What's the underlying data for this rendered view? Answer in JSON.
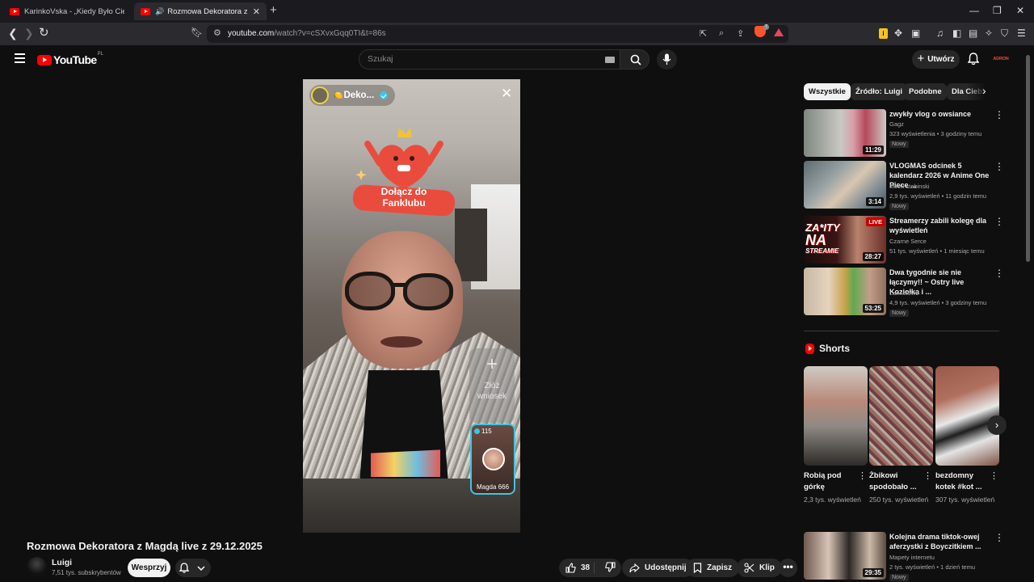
{
  "browser": {
    "tabs": [
      {
        "label": "KarinkoVska - „Kiedy Było Ciemno” (",
        "active": false
      },
      {
        "label": "Rozmowa Dekoratora z Magd",
        "active": true
      }
    ],
    "url_domain": "youtube.com",
    "url_path": "/watch?v=cSXvxGqq0TI&t=86s",
    "brave_badge": "7"
  },
  "masthead": {
    "logo_text": "YouTube",
    "country_code": "PL",
    "search_placeholder": "Szukaj",
    "create_label": "Utwórz",
    "avatar_text": "ADRON"
  },
  "player": {
    "channel_name": "Deko...",
    "channel_emoji": "🍋",
    "fan_club_line1": "Dołącz do",
    "fan_club_line2": "Fanklubu",
    "request_label_line1": "Złóż",
    "request_label_line2": "wniosek",
    "guest_count": "115",
    "guest_name": "Magda 666"
  },
  "video": {
    "title": "Rozmowa Dekoratora z Magdą live z 29.12.2025",
    "channel": "Luigi",
    "subscribers": "7,51 tys. subskrybentów",
    "support_label": "Wesprzyj",
    "likes": "38",
    "share_label": "Udostępnij",
    "save_label": "Zapisz",
    "clip_label": "Klip",
    "more_label": "•••"
  },
  "sidebar": {
    "chips": [
      "Wszystkie",
      "Źródło: Luigi",
      "Podobne",
      "Dla Ciebie"
    ],
    "recommendations": [
      {
        "title": "zwykły vlog o owsiance",
        "channel": "Gagz",
        "meta": "323 wyświetlenia • 3 godziny temu",
        "badge": "Nowy",
        "duration": "11:29"
      },
      {
        "title": "VLOGMAS odcinek 5 kalendarz 2026 w Anime One Piece ...",
        "channel": "Mirek stabinski",
        "meta": "2,9 tys. wyświetleń • 11 godzin temu",
        "badge": "Nowy",
        "duration": "3:14"
      },
      {
        "title": "Streamerzy zabili kolegę dla wyświetleń",
        "channel": "Czarne Serce",
        "meta": "51 tys. wyświetleń • 1 miesiąc temu",
        "badge": "",
        "duration": "28:27",
        "live_badge": "LIVE",
        "thumb_text_1": "ZA*ITY",
        "thumb_text_2": "NA",
        "thumb_text_3": "STREAMIE"
      },
      {
        "title": "Dwa tygodnie sie nie łączymy!! ~ Ostry live Koziołka i ...",
        "channel": "Lannelowo",
        "meta": "4,9 tys. wyświetleń • 3 godziny temu",
        "badge": "Nowy",
        "duration": "53:25"
      },
      {
        "title": "Kolejna drama tiktok-owej aferzystki z Boyczitkiem ...",
        "channel": "Mapety internetu",
        "meta": "2 tys. wyświetleń • 1 dzień temu",
        "badge": "Nowy",
        "duration": "29:35"
      }
    ],
    "shorts_heading": "Shorts",
    "shorts": [
      {
        "title": "Robią pod górkę",
        "views": "2,3 tys. wyświetleń"
      },
      {
        "title": "Żbikowi spodobało ...",
        "views": "250 tys. wyświetleń"
      },
      {
        "title": "bezdomny kotek #kot ...",
        "views": "307 tys. wyświetleń"
      }
    ]
  },
  "colors": {
    "background": "#0f0f0f",
    "youtube_red": "#ff0000",
    "verified_cyan": "#3ec6e0",
    "chip_active": "#f1f1f1"
  }
}
